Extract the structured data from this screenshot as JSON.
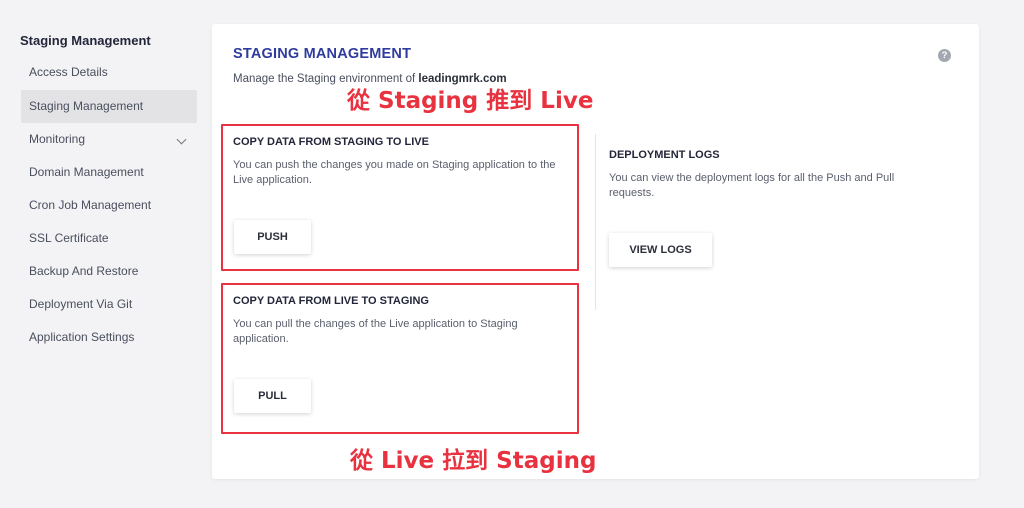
{
  "sidebar": {
    "title": "Staging Management",
    "items": [
      {
        "label": "Access Details"
      },
      {
        "label": "Staging Management"
      },
      {
        "label": "Monitoring"
      },
      {
        "label": "Domain Management"
      },
      {
        "label": "Cron Job Management"
      },
      {
        "label": "SSL Certificate"
      },
      {
        "label": "Backup And Restore"
      },
      {
        "label": "Deployment Via Git"
      },
      {
        "label": "Application Settings"
      }
    ]
  },
  "card": {
    "title": "STAGING MANAGEMENT",
    "subtitle_prefix": "Manage the Staging environment of ",
    "subtitle_domain": "leadingmrk.com",
    "help_glyph": "?"
  },
  "sections": {
    "push": {
      "title": "COPY DATA FROM STAGING TO LIVE",
      "desc": "You can push the changes you made on Staging application to the Live application.",
      "button": "PUSH"
    },
    "pull": {
      "title": "COPY DATA FROM LIVE TO STAGING",
      "desc": "You can pull the changes of the Live application to Staging application.",
      "button": "PULL"
    },
    "logs": {
      "title": "DEPLOYMENT LOGS",
      "desc": "You can view the deployment logs for all the Push and Pull requests.",
      "button": "VIEW LOGS"
    }
  },
  "annotations": {
    "top": "從 Staging 推到 Live",
    "bottom": "從 Live 拉到 Staging",
    "color": "#e8323f"
  },
  "colors": {
    "accent": "#2f3c9e",
    "background": "#f3f3f5"
  }
}
